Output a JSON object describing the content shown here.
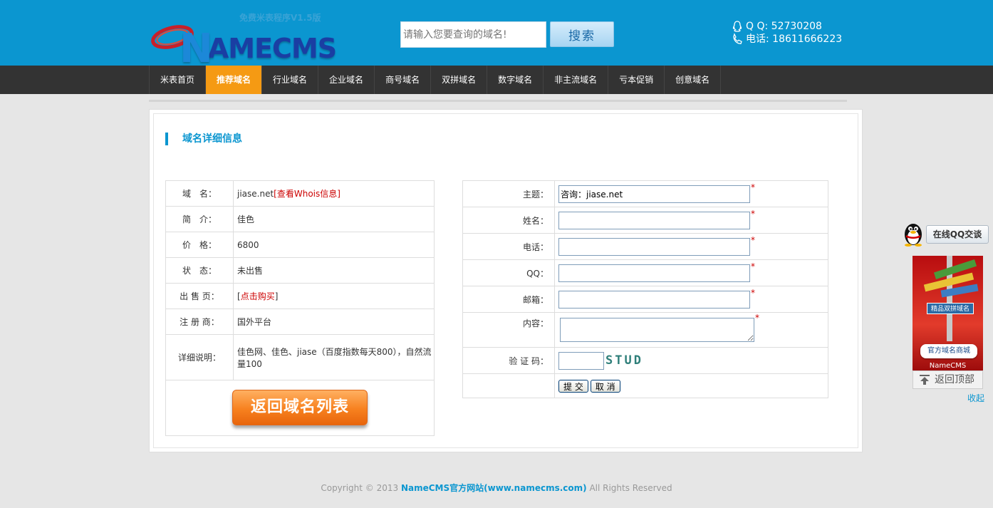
{
  "header": {
    "logo_tag": "免费米表程序V1.5版",
    "logo_text": "AMECMS",
    "logo_letter": "N",
    "search_placeholder": "请输入您要查询的域名!",
    "search_button": "搜索",
    "qq": "Q Q: 52730208",
    "phone": "电话: 18611666223"
  },
  "nav": {
    "items": [
      "米表首页",
      "推荐域名",
      "行业域名",
      "企业域名",
      "商号域名",
      "双拼域名",
      "数字域名",
      "非主流域名",
      "亏本促销",
      "创意域名"
    ],
    "active_index": 1
  },
  "section_title": "域名详细信息",
  "info": {
    "rows": [
      {
        "label": "域　名：",
        "value": "jiase.net",
        "link": "[查看Whois信息]"
      },
      {
        "label": "简　介：",
        "value": "佳色"
      },
      {
        "label": "价　格：",
        "value": "6800"
      },
      {
        "label": "状　态：",
        "value": "未出售"
      },
      {
        "label": "出 售 页：",
        "link": "点击购买"
      },
      {
        "label": "注 册 商：",
        "value": "国外平台"
      },
      {
        "label": "详细说明：",
        "value": "佳色网、佳色、jiase（百度指数每天800），自然流量100"
      }
    ],
    "back_button": "返回域名列表"
  },
  "form": {
    "subject_label": "主题：",
    "subject_value": "咨询：jiase.net",
    "name_label": "姓名：",
    "phone_label": "电话：",
    "qq_label": "QQ：",
    "email_label": "邮箱：",
    "content_label": "内容：",
    "captcha_label": "验 证 码：",
    "captcha_text": "STUD",
    "submit": "提 交",
    "cancel": "取 消",
    "required_mark": "*"
  },
  "footer": {
    "prefix": "Copyright © 2013 ",
    "site": "NameCMS官方网站(www.namecms.com)",
    "suffix": " All Rights Reserved"
  },
  "sidebar": {
    "qq_chat": "在线QQ交谈",
    "ad_sign": "精品双拼域名",
    "ad_button": "官方域名商城",
    "ad_brand": "NameCMS",
    "back_top": "返回顶部",
    "collapse": "收起"
  },
  "colors": {
    "header_bg": "#0b96d0",
    "nav_bg": "#333333",
    "nav_active": "#f59a13",
    "accent": "#0b96d0",
    "link_red": "#cc0000"
  }
}
